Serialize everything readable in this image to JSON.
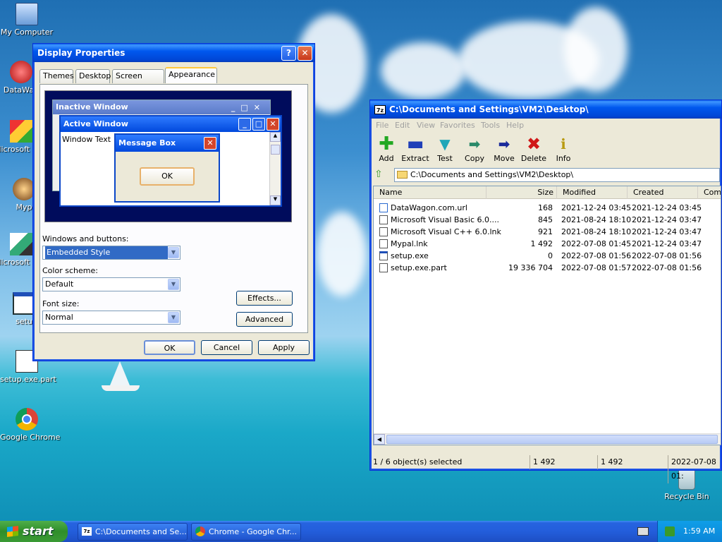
{
  "desktop": {
    "icons": [
      {
        "label": "My Computer"
      },
      {
        "label": "DataWag"
      },
      {
        "label": "Microsoft C++"
      },
      {
        "label": "Myp"
      },
      {
        "label": "Microsoft Basic"
      },
      {
        "label": "setu"
      },
      {
        "label": "setup.exe.part"
      },
      {
        "label": "Google Chrome"
      },
      {
        "label": "Recycle Bin"
      }
    ]
  },
  "display_properties": {
    "title": "Display Properties",
    "tabs": [
      "Themes",
      "Desktop",
      "Screen Saver",
      "Appearance"
    ],
    "active_tab": "Appearance",
    "preview": {
      "inactive_title": "Inactive Window",
      "active_title": "Active Window",
      "window_text": "Window Text",
      "msgbox_title": "Message Box",
      "msgbox_ok": "OK"
    },
    "windows_buttons_label": "Windows and buttons:",
    "windows_buttons_value": "Embedded Style",
    "color_scheme_label": "Color scheme:",
    "color_scheme_value": "Default",
    "font_size_label": "Font size:",
    "font_size_value": "Normal",
    "effects_button": "Effects...",
    "advanced_button": "Advanced",
    "ok_button": "OK",
    "cancel_button": "Cancel",
    "apply_button": "Apply"
  },
  "sevenzip": {
    "title": "C:\\Documents and Settings\\VM2\\Desktop\\",
    "menu": [
      "File",
      "Edit",
      "View",
      "Favorites",
      "Tools",
      "Help"
    ],
    "toolbar": [
      "Add",
      "Extract",
      "Test",
      "Copy",
      "Move",
      "Delete",
      "Info"
    ],
    "path": "C:\\Documents and Settings\\VM2\\Desktop\\",
    "columns": [
      "Name",
      "Size",
      "Modified",
      "Created",
      "Comm"
    ],
    "rows": [
      {
        "name": "DataWagon.com.url",
        "size": "168",
        "modified": "2021-12-24 03:45",
        "created": "2021-12-24 03:45"
      },
      {
        "name": "Microsoft Visual Basic 6.0....",
        "size": "845",
        "modified": "2021-08-24 18:10",
        "created": "2021-12-24 03:47"
      },
      {
        "name": "Microsoft Visual C++ 6.0.lnk",
        "size": "921",
        "modified": "2021-08-24 18:10",
        "created": "2021-12-24 03:47"
      },
      {
        "name": "Mypal.lnk",
        "size": "1 492",
        "modified": "2022-07-08 01:45",
        "created": "2021-12-24 03:47"
      },
      {
        "name": "setup.exe",
        "size": "0",
        "modified": "2022-07-08 01:56",
        "created": "2022-07-08 01:56"
      },
      {
        "name": "setup.exe.part",
        "size": "19 336 704",
        "modified": "2022-07-08 01:57",
        "created": "2022-07-08 01:56"
      }
    ],
    "status": {
      "selected": "1 / 6 object(s) selected",
      "size": "1 492",
      "packed": "1 492",
      "date": "2022-07-08 01:"
    }
  },
  "taskbar": {
    "start": "start",
    "items": [
      "C:\\Documents and Se...",
      "Chrome - Google Chr..."
    ],
    "clock": "1:59 AM"
  }
}
